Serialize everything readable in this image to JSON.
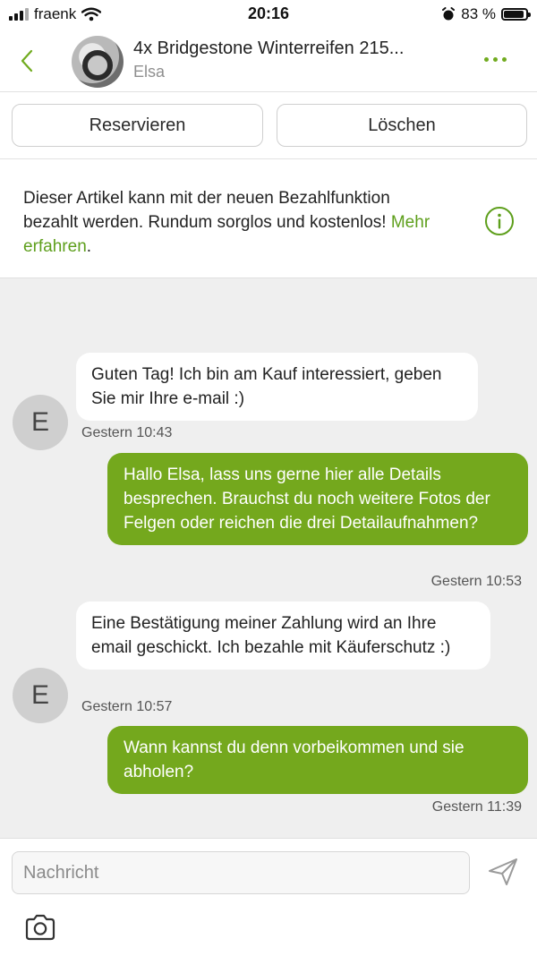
{
  "status_bar": {
    "carrier": "fraenk",
    "time": "20:16",
    "battery_percent": "83 %",
    "battery_level": 0.83
  },
  "header": {
    "title": "4x Bridgestone Winterreifen 215...",
    "subtitle": "Elsa",
    "icons": [
      "back-chevron-icon",
      "product-thumbnail",
      "more-dots-icon"
    ],
    "accent_color": "#71ab1f"
  },
  "actions": {
    "reserve_label": "Reservieren",
    "delete_label": "Löschen"
  },
  "info_banner": {
    "text": "Dieser Artikel kann mit der neuen Bezahlfunktion bezahlt werden. Rundum sorglos und kostenlos! ",
    "link_text": "Mehr erfahren",
    "after_link": ".",
    "icon": "info-icon"
  },
  "messages": [
    {
      "direction": "incoming",
      "avatar_initial": "E",
      "text": "Guten Tag! Ich bin am Kauf interessiert, geben Sie mir Ihre e-mail  :)",
      "timestamp": "Gestern 10:43"
    },
    {
      "direction": "outgoing",
      "text": "Hallo Elsa, lass uns gerne hier alle Details besprechen. Brauchst du noch weitere Fotos der Felgen oder reichen die drei Detailaufnahmen?",
      "timestamp": "Gestern 10:53"
    },
    {
      "direction": "incoming",
      "avatar_initial": "E",
      "text": "Eine Bestätigung meiner Zahlung wird an Ihre email geschickt. Ich bezahle mit Käuferschutz :)",
      "timestamp": "Gestern 10:57"
    },
    {
      "direction": "outgoing",
      "text": "Wann kannst du denn vorbeikommen und sie abholen?",
      "timestamp": "Gestern 11:39"
    }
  ],
  "composer": {
    "placeholder": "Nachricht",
    "send_icon": "send-icon",
    "camera_icon": "camera-icon"
  },
  "colors": {
    "outgoing_bubble": "#74a81d",
    "link": "#5e9f1c",
    "chat_background": "#efefef"
  }
}
